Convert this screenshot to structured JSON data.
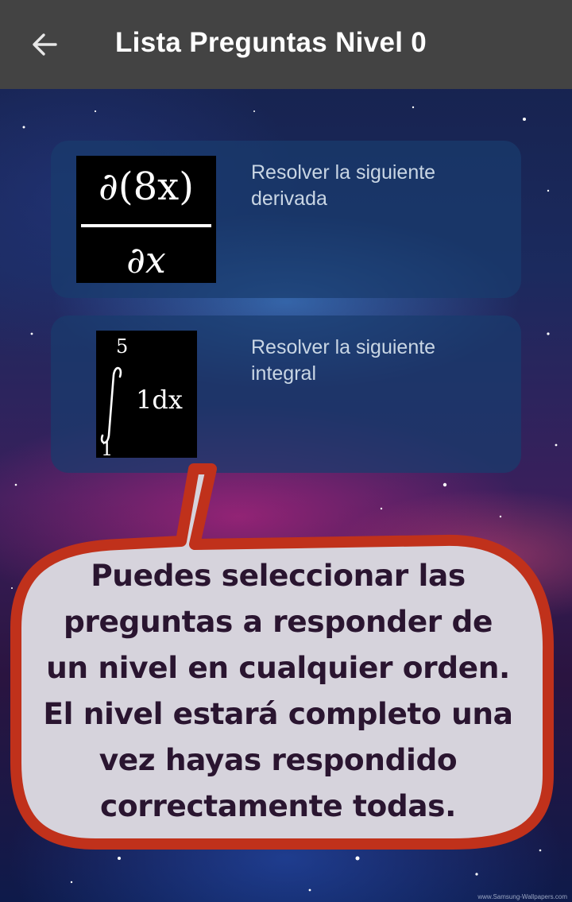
{
  "appbar": {
    "back_icon": "arrow-left-icon",
    "title": "Lista Preguntas Nivel 0",
    "background": "#434343"
  },
  "questions": [
    {
      "formula_kind": "derivative",
      "formula": {
        "numerator": "∂(8x)",
        "denominator": "∂x"
      },
      "description": "Resolver la siguiente derivada"
    },
    {
      "formula_kind": "definite-integral",
      "formula": {
        "upper": "5",
        "lower": "1",
        "integrand": "1dx"
      },
      "description": "Resolver la siguiente integral"
    }
  ],
  "tooltip": {
    "lines": [
      "Puedes seleccionar las",
      "preguntas a responder de",
      "un nivel en cualquier orden.",
      "El nivel estará completo una",
      "vez hayas respondido",
      "correctamente todas."
    ],
    "border_color": "#c0311b",
    "fill_color": "#d6d3dc"
  },
  "watermark": "www.Samsung-Wallpapers.com"
}
